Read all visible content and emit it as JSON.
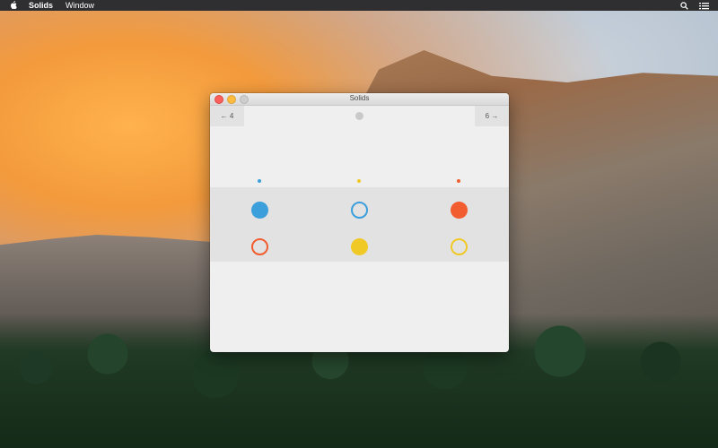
{
  "menubar": {
    "app_name": "Solids",
    "menus": [
      "Window"
    ],
    "icons": [
      "apple-icon",
      "search-icon",
      "list-icon"
    ]
  },
  "window": {
    "title": "Solids",
    "nav": {
      "prev_label": "← 4",
      "next_label": "6 →"
    }
  },
  "colors": {
    "blue": "#3b9fdc",
    "yellow": "#f1c927",
    "orange": "#f15d2f",
    "page_dot": "#c9c9c9"
  },
  "palette_indicators": [
    "blue",
    "yellow",
    "orange"
  ],
  "swatches": [
    [
      {
        "color": "blue",
        "style": "solid"
      },
      {
        "color": "blue",
        "style": "ring"
      },
      {
        "color": "orange",
        "style": "solid"
      }
    ],
    [
      {
        "color": "orange",
        "style": "ring"
      },
      {
        "color": "yellow",
        "style": "solid"
      },
      {
        "color": "yellow",
        "style": "ring"
      }
    ]
  ]
}
